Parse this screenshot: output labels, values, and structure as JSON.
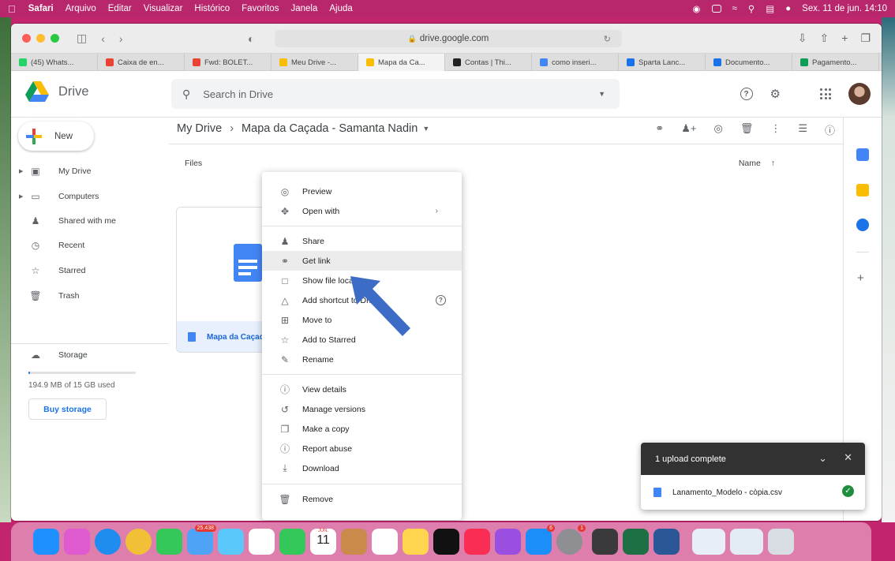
{
  "menubar": {
    "apple": "",
    "items": [
      "Safari",
      "Arquivo",
      "Editar",
      "Visualizar",
      "Histórico",
      "Favoritos",
      "Janela",
      "Ajuda"
    ],
    "clock": "Sex. 11 de jun. 14:10"
  },
  "browser": {
    "url": "drive.google.com",
    "tabs": [
      {
        "label": "(45) Whats...",
        "color": "#25d366"
      },
      {
        "label": "Caixa de en...",
        "color": "#ea4335"
      },
      {
        "label": "Fwd: BOLET...",
        "color": "#ea4335"
      },
      {
        "label": "Meu Drive -...",
        "color": "#fbbc04"
      },
      {
        "label": "Mapa da Ca...",
        "color": "#fbbc04",
        "active": true
      },
      {
        "label": "Contas | Thi...",
        "color": "#222222"
      },
      {
        "label": "como inseri...",
        "color": "#4285f4"
      },
      {
        "label": "Sparta Lanc...",
        "color": "#1a73e8"
      },
      {
        "label": "Documento...",
        "color": "#1a73e8"
      },
      {
        "label": "Pagamento...",
        "color": "#0f9d58"
      }
    ]
  },
  "drive": {
    "app_name": "Drive",
    "search_placeholder": "Search in Drive",
    "new_label": "New",
    "nav": [
      {
        "label": "My Drive",
        "icon": "my-drive-icon",
        "expandable": true
      },
      {
        "label": "Computers",
        "icon": "computer-icon",
        "expandable": true
      },
      {
        "label": "Shared with me",
        "icon": "shared-icon",
        "expandable": false
      },
      {
        "label": "Recent",
        "icon": "clock-icon",
        "expandable": false
      },
      {
        "label": "Starred",
        "icon": "star-icon",
        "expandable": false
      },
      {
        "label": "Trash",
        "icon": "trash-icon",
        "expandable": false
      }
    ],
    "storage_label": "Storage",
    "storage_used": "194.9 MB of 15 GB used",
    "storage_fraction": 0.013,
    "buy_storage": "Buy storage",
    "breadcrumb_root": "My Drive",
    "breadcrumb_folder": "Mapa da Caçada - Samanta Nadin",
    "files_label": "Files",
    "sort_label": "Name",
    "file_name": "Mapa da Caçada"
  },
  "context_menu": {
    "items": [
      {
        "label": "Preview",
        "icon": "eye-icon"
      },
      {
        "label": "Open with",
        "icon": "move-arrows-icon",
        "submenu": true
      },
      {
        "label": "Share",
        "icon": "person-add-icon"
      },
      {
        "label": "Get link",
        "icon": "link-icon",
        "highlighted": true
      },
      {
        "label": "Show file location",
        "icon": "folder-icon"
      },
      {
        "label": "Add shortcut to Drive",
        "icon": "shortcut-icon",
        "help": true
      },
      {
        "label": "Move to",
        "icon": "move-to-icon"
      },
      {
        "label": "Add to Starred",
        "icon": "star-icon"
      },
      {
        "label": "Rename",
        "icon": "pencil-icon"
      },
      {
        "label": "View details",
        "icon": "info-icon"
      },
      {
        "label": "Manage versions",
        "icon": "history-icon"
      },
      {
        "label": "Make a copy",
        "icon": "copy-icon"
      },
      {
        "label": "Report abuse",
        "icon": "alert-icon"
      },
      {
        "label": "Download",
        "icon": "download-icon"
      },
      {
        "label": "Remove",
        "icon": "trash-icon"
      }
    ]
  },
  "upload_toast": {
    "title": "1 upload complete",
    "file": "Lanamento_Modelo - còpia.csv"
  },
  "dock": {
    "mail_badge": "25.438",
    "calendar_month": "JUN.",
    "calendar_day": "11",
    "appstore_badge": "6",
    "settings_badge": "1"
  }
}
